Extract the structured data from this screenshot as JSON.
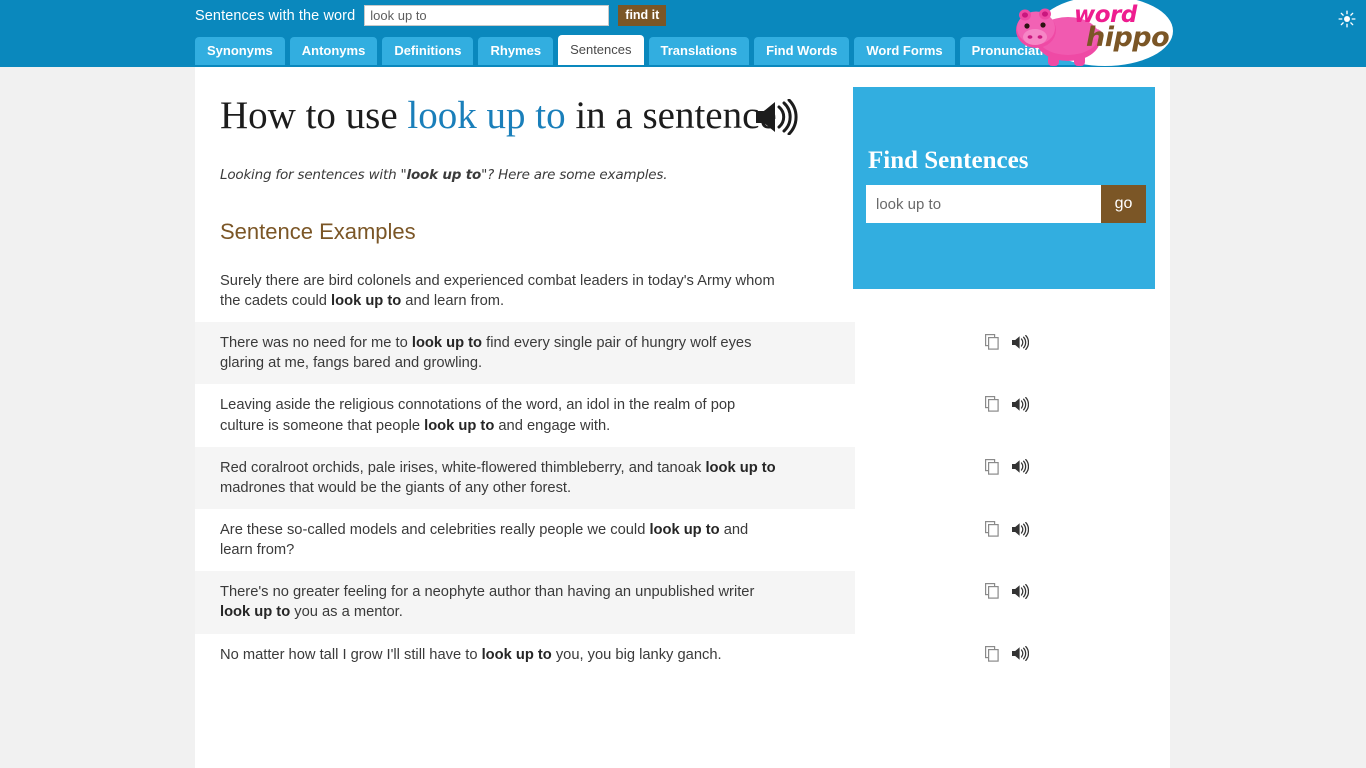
{
  "header": {
    "search_label": "Sentences with the word",
    "search_value": "look up to",
    "find_button": "find it",
    "brightness_icon": "sun-brightness-icon"
  },
  "logo": {
    "word": "word",
    "hippo": "hippo"
  },
  "tabs": [
    {
      "label": "Synonyms",
      "active": false
    },
    {
      "label": "Antonyms",
      "active": false
    },
    {
      "label": "Definitions",
      "active": false
    },
    {
      "label": "Rhymes",
      "active": false
    },
    {
      "label": "Sentences",
      "active": true
    },
    {
      "label": "Translations",
      "active": false
    },
    {
      "label": "Find Words",
      "active": false
    },
    {
      "label": "Word Forms",
      "active": false
    },
    {
      "label": "Pronunciations",
      "active": false
    }
  ],
  "main": {
    "title_prefix": "How to use ",
    "title_word": "look up to",
    "title_suffix": " in a sentence",
    "subtitle_prefix": "Looking for sentences with \"",
    "subtitle_word": "look up to",
    "subtitle_suffix": "\"? Here are some examples.",
    "section_heading": "Sentence Examples",
    "speaker_icon": "speaker-icon",
    "copy_icon": "copy-icon",
    "sentences": [
      {
        "pre": "Surely there are bird colonels and experienced combat leaders in today's Army whom the cadets could ",
        "bold": "look up to",
        "post": " and learn from."
      },
      {
        "pre": "There was no need for me to ",
        "bold": "look up to",
        "post": " find every single pair of hungry wolf eyes glaring at me, fangs bared and growling."
      },
      {
        "pre": "Leaving aside the religious connotations of the word, an idol in the realm of pop culture is someone that people ",
        "bold": "look up to",
        "post": " and engage with."
      },
      {
        "pre": "Red coralroot orchids, pale irises, white-flowered thimbleberry, and tanoak ",
        "bold": "look up to",
        "post": " madrones that would be the giants of any other forest."
      },
      {
        "pre": "Are these so-called models and celebrities really people we could ",
        "bold": "look up to",
        "post": " and learn from?"
      },
      {
        "pre": "There's no greater feeling for a neophyte author than having an unpublished writer ",
        "bold": "look up to",
        "post": " you as a mentor."
      },
      {
        "pre": "No matter how tall I grow I'll still have to ",
        "bold": "look up to",
        "post": " you, you big lanky ganch."
      }
    ]
  },
  "sidebar": {
    "title": "Find Sentences",
    "input_placeholder": "look up to",
    "go_button": "go"
  },
  "colors": {
    "header_blue": "#0a88bd",
    "tab_blue": "#32aee0",
    "brown": "#7b5626",
    "link_blue": "#1a7fba",
    "page_bg": "#f1f1f1",
    "row_alt": "#f5f5f5",
    "logo_pink": "#ee1d8f"
  }
}
